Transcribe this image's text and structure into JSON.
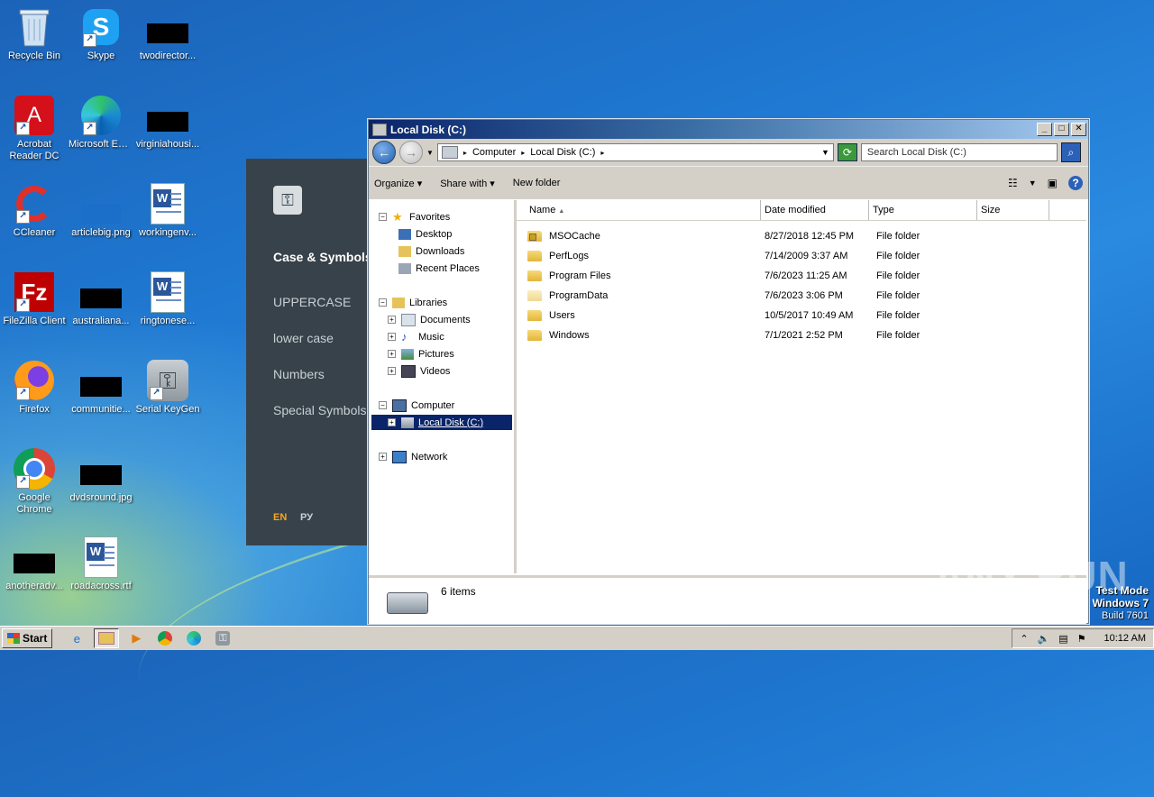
{
  "desktop": {
    "icons": [
      {
        "label": "Recycle Bin"
      },
      {
        "label": "Skype"
      },
      {
        "label": "twodirector..."
      },
      {
        "label": "Acrobat Reader DC"
      },
      {
        "label": "Microsoft Edge"
      },
      {
        "label": "virginiahousi..."
      },
      {
        "label": "CCleaner"
      },
      {
        "label": "articlebig.png"
      },
      {
        "label": "workingenv..."
      },
      {
        "label": "FileZilla Client"
      },
      {
        "label": "australiana..."
      },
      {
        "label": "ringtonese..."
      },
      {
        "label": "Firefox"
      },
      {
        "label": "communitie..."
      },
      {
        "label": "Serial KeyGen"
      },
      {
        "label": "Google Chrome"
      },
      {
        "label": "dvdsround.jpg"
      },
      {
        "label": "anotheradv..."
      },
      {
        "label": "roadacross.rtf"
      }
    ]
  },
  "keygen": {
    "title": "Case & Symbols",
    "items": [
      "UPPERCASE",
      "lower case",
      "Numbers",
      "Special Symbols"
    ],
    "lang_en": "EN",
    "lang_ru": "РУ"
  },
  "window": {
    "title": "Local Disk (C:)",
    "address": {
      "seg1": "Computer",
      "seg2": "Local Disk (C:)"
    },
    "search_placeholder": "Search Local Disk (C:)",
    "toolbar": {
      "organize": "Organize",
      "share": "Share with",
      "new_folder": "New folder"
    },
    "nav": {
      "favorites": "Favorites",
      "desktop": "Desktop",
      "downloads": "Downloads",
      "recent": "Recent Places",
      "libraries": "Libraries",
      "documents": "Documents",
      "music": "Music",
      "pictures": "Pictures",
      "videos": "Videos",
      "computer": "Computer",
      "local_disk": "Local Disk (C:)",
      "network": "Network"
    },
    "columns": {
      "name": "Name",
      "date": "Date modified",
      "type": "Type",
      "size": "Size"
    },
    "files": [
      {
        "name": "MSOCache",
        "date": "8/27/2018 12:45 PM",
        "type": "File folder"
      },
      {
        "name": "PerfLogs",
        "date": "7/14/2009 3:37 AM",
        "type": "File folder"
      },
      {
        "name": "Program Files",
        "date": "7/6/2023 11:25 AM",
        "type": "File folder"
      },
      {
        "name": "ProgramData",
        "date": "7/6/2023 3:06 PM",
        "type": "File folder"
      },
      {
        "name": "Users",
        "date": "10/5/2017 10:49 AM",
        "type": "File folder"
      },
      {
        "name": "Windows",
        "date": "7/1/2021 2:52 PM",
        "type": "File folder"
      }
    ],
    "status": "6 items"
  },
  "watermark": {
    "text": "ANY RUN",
    "test_mode": "Test Mode",
    "os": "Windows 7",
    "build": "Build 7601"
  },
  "taskbar": {
    "start": "Start",
    "clock": "10:12 AM"
  }
}
